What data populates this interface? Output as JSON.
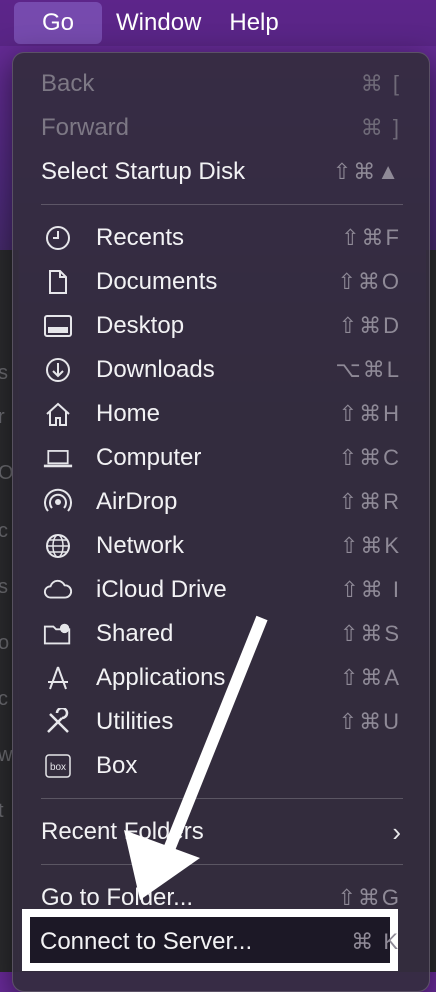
{
  "menubar": {
    "items": [
      "Go",
      "Window",
      "Help"
    ]
  },
  "menu": {
    "top_items": [
      {
        "label": "Back",
        "shortcut": "⌘ [",
        "disabled": true
      },
      {
        "label": "Forward",
        "shortcut": "⌘ ]",
        "disabled": true
      },
      {
        "label": "Select Startup Disk",
        "shortcut": "⇧⌘▲",
        "disabled": false
      }
    ],
    "places": [
      {
        "label": "Recents",
        "icon": "clock-icon",
        "shortcut": "⇧⌘F"
      },
      {
        "label": "Documents",
        "icon": "document-icon",
        "shortcut": "⇧⌘O"
      },
      {
        "label": "Desktop",
        "icon": "desktop-icon",
        "shortcut": "⇧⌘D"
      },
      {
        "label": "Downloads",
        "icon": "download-icon",
        "shortcut": "⌥⌘L"
      },
      {
        "label": "Home",
        "icon": "home-icon",
        "shortcut": "⇧⌘H"
      },
      {
        "label": "Computer",
        "icon": "laptop-icon",
        "shortcut": "⇧⌘C"
      },
      {
        "label": "AirDrop",
        "icon": "airdrop-icon",
        "shortcut": "⇧⌘R"
      },
      {
        "label": "Network",
        "icon": "globe-icon",
        "shortcut": "⇧⌘K"
      },
      {
        "label": "iCloud Drive",
        "icon": "cloud-icon",
        "shortcut": "⇧⌘ I"
      },
      {
        "label": "Shared",
        "icon": "shared-folder-icon",
        "shortcut": "⇧⌘S"
      },
      {
        "label": "Applications",
        "icon": "applications-icon",
        "shortcut": "⇧⌘A"
      },
      {
        "label": "Utilities",
        "icon": "utilities-icon",
        "shortcut": "⇧⌘U"
      },
      {
        "label": "Box",
        "icon": "box-icon",
        "shortcut": ""
      }
    ],
    "recent_folders": {
      "label": "Recent Folders",
      "chevron": "›"
    },
    "bottom_items": [
      {
        "label": "Go to Folder...",
        "shortcut": "⇧⌘G"
      },
      {
        "label": "Connect to Server...",
        "shortcut": "⌘ K"
      }
    ]
  }
}
